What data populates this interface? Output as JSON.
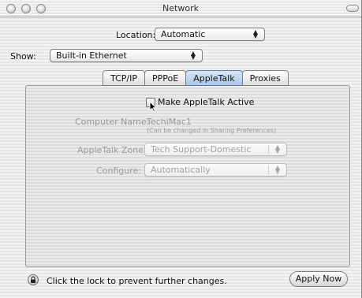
{
  "window": {
    "title": "Network"
  },
  "location": {
    "label": "Location:",
    "value": "Automatic"
  },
  "show": {
    "label": "Show:",
    "value": "Built-in Ethernet"
  },
  "tabs": [
    {
      "label": "TCP/IP",
      "active": false
    },
    {
      "label": "PPPoE",
      "active": false
    },
    {
      "label": "AppleTalk",
      "active": true
    },
    {
      "label": "Proxies",
      "active": false
    }
  ],
  "appletalk": {
    "make_active_label": "Make AppleTalk Active",
    "make_active_checked": false,
    "computer_name_label": "Computer Name:",
    "computer_name_value": "TechiMac1",
    "computer_name_note": "(Can be changed in Sharing Preferences)",
    "zone_label": "AppleTalk Zone:",
    "zone_value": "Tech Support-Domestic",
    "configure_label": "Configure:",
    "configure_value": "Automatically"
  },
  "footer": {
    "lock_text": "Click the lock to prevent further changes.",
    "apply_label": "Apply Now"
  },
  "icons": {
    "lock": "lock-icon",
    "popup_arrows": "updown-arrows-icon",
    "cursor": "arrow-cursor-icon"
  },
  "colors": {
    "active_tab": "#aac6e8",
    "disabled_text": "#9a9a9a"
  }
}
